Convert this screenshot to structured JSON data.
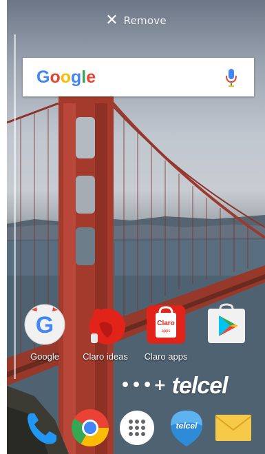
{
  "remove_bar": {
    "label": "Remove"
  },
  "search": {
    "logo_text": "Google"
  },
  "apps": [
    {
      "label": "Google",
      "icon": "google-app-icon"
    },
    {
      "label": "Claro ideas",
      "icon": "claro-ideas-icon"
    },
    {
      "label": "Claro apps",
      "icon": "claro-apps-icon"
    },
    {
      "label": "",
      "icon": "play-store-icon"
    }
  ],
  "claro_apps_badge": "Claro",
  "claro_apps_sub": "apps",
  "telcel": {
    "dots": "•••+",
    "brand": "telcel"
  },
  "dock": [
    {
      "icon": "phone-icon"
    },
    {
      "icon": "chrome-icon"
    },
    {
      "icon": "app-drawer-icon"
    },
    {
      "icon": "telcel-app-icon",
      "label": "telcel"
    },
    {
      "icon": "email-icon"
    }
  ],
  "colors": {
    "google_blue": "#4285F4",
    "google_red": "#EA4335",
    "google_yellow": "#FBBC05",
    "google_green": "#34A853",
    "claro_red": "#e2231a",
    "bridge_red": "#a43a2c"
  }
}
